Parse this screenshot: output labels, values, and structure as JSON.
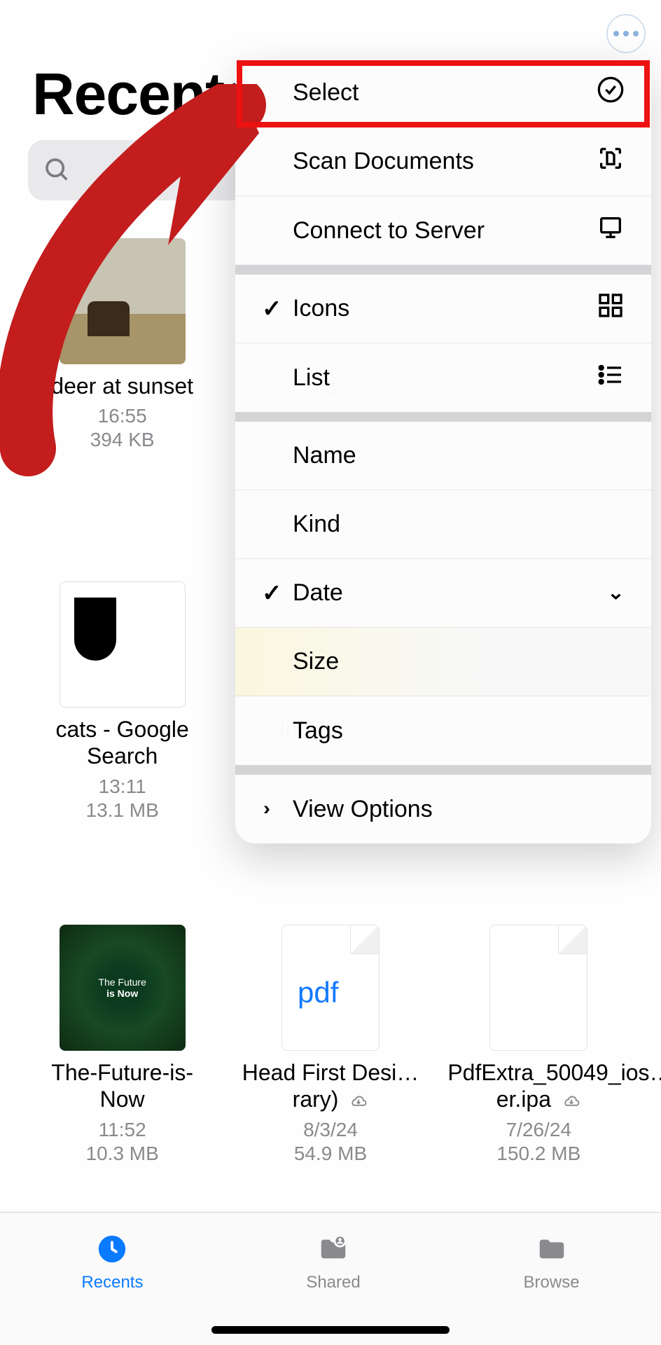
{
  "header": {
    "title": "Recents"
  },
  "search": {
    "placeholder": ""
  },
  "menu": {
    "select": "Select",
    "scan": "Scan Documents",
    "connect": "Connect to Server",
    "view_icons": "Icons",
    "view_list": "List",
    "sort_name": "Name",
    "sort_kind": "Kind",
    "sort_date": "Date",
    "sort_size": "Size",
    "sort_tags": "Tags",
    "view_options": "View Options",
    "current_view": "Icons",
    "current_sort": "Date"
  },
  "files": [
    {
      "name": "deer at sunset",
      "time": "16:55",
      "size": "394 KB",
      "thumb": "deer",
      "cloud": false
    },
    {
      "name": "d",
      "time": "",
      "size": "",
      "thumb": "",
      "cloud": false
    },
    {
      "name": "",
      "time": "",
      "size": "",
      "thumb": "",
      "cloud": false
    },
    {
      "name": "cats - Google Search",
      "time": "13:11",
      "size": "13.1 MB",
      "thumb": "cats",
      "cloud": false
    },
    {
      "name": "I",
      "time": "",
      "size": "",
      "thumb": "",
      "cloud": false
    },
    {
      "name": "",
      "time": "",
      "size": "",
      "thumb": "",
      "cloud": false
    },
    {
      "name": "The-Future-is-Now",
      "time": "11:52",
      "size": "10.3 MB",
      "thumb": "future",
      "cloud": false
    },
    {
      "name": "Head First Desi…rary)",
      "time": "8/3/24",
      "size": "54.9 MB",
      "thumb": "pdf",
      "cloud": true
    },
    {
      "name": "PdfExtra_50049_ios…er.ipa",
      "time": "7/26/24",
      "size": "150.2 MB",
      "thumb": "blank",
      "cloud": true
    }
  ],
  "tabs": {
    "recents": "Recents",
    "shared": "Shared",
    "browse": "Browse",
    "active": "recents"
  },
  "thumb_text": {
    "pdf": "pdf",
    "future_line1": "The Future",
    "future_line2": "is Now"
  },
  "annotation": {
    "arrow_color": "#c31d1d"
  }
}
